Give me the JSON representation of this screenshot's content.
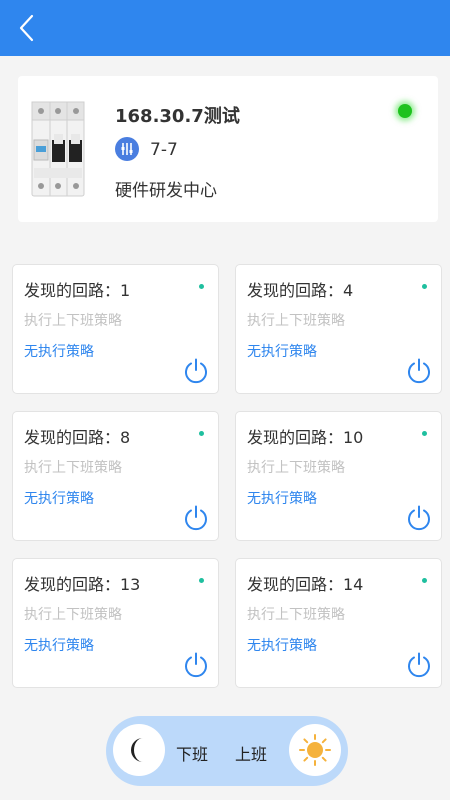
{
  "header": {
    "bg_color": "#2f86ee",
    "back_icon": "chevron-left-icon"
  },
  "device": {
    "name": "168.30.7测试",
    "model": "7-7",
    "department": "硬件研发中心",
    "status_color": "#1ec21e"
  },
  "circuits": [
    {
      "title": "发现的回路：1",
      "subtitle": "执行上下班策略",
      "policy": "无执行策略"
    },
    {
      "title": "发现的回路：4",
      "subtitle": "执行上下班策略",
      "policy": "无执行策略"
    },
    {
      "title": "发现的回路：8",
      "subtitle": "执行上下班策略",
      "policy": "无执行策略"
    },
    {
      "title": "发现的回路：10",
      "subtitle": "执行上下班策略",
      "policy": "无执行策略"
    },
    {
      "title": "发现的回路：13",
      "subtitle": "执行上下班策略",
      "policy": "无执行策略"
    },
    {
      "title": "发现的回路：14",
      "subtitle": "执行上下班策略",
      "policy": "无执行策略"
    }
  ],
  "toggle": {
    "off_label": "下班",
    "on_label": "上班",
    "off_icon": "moon-icon",
    "on_icon": "sun-icon"
  }
}
